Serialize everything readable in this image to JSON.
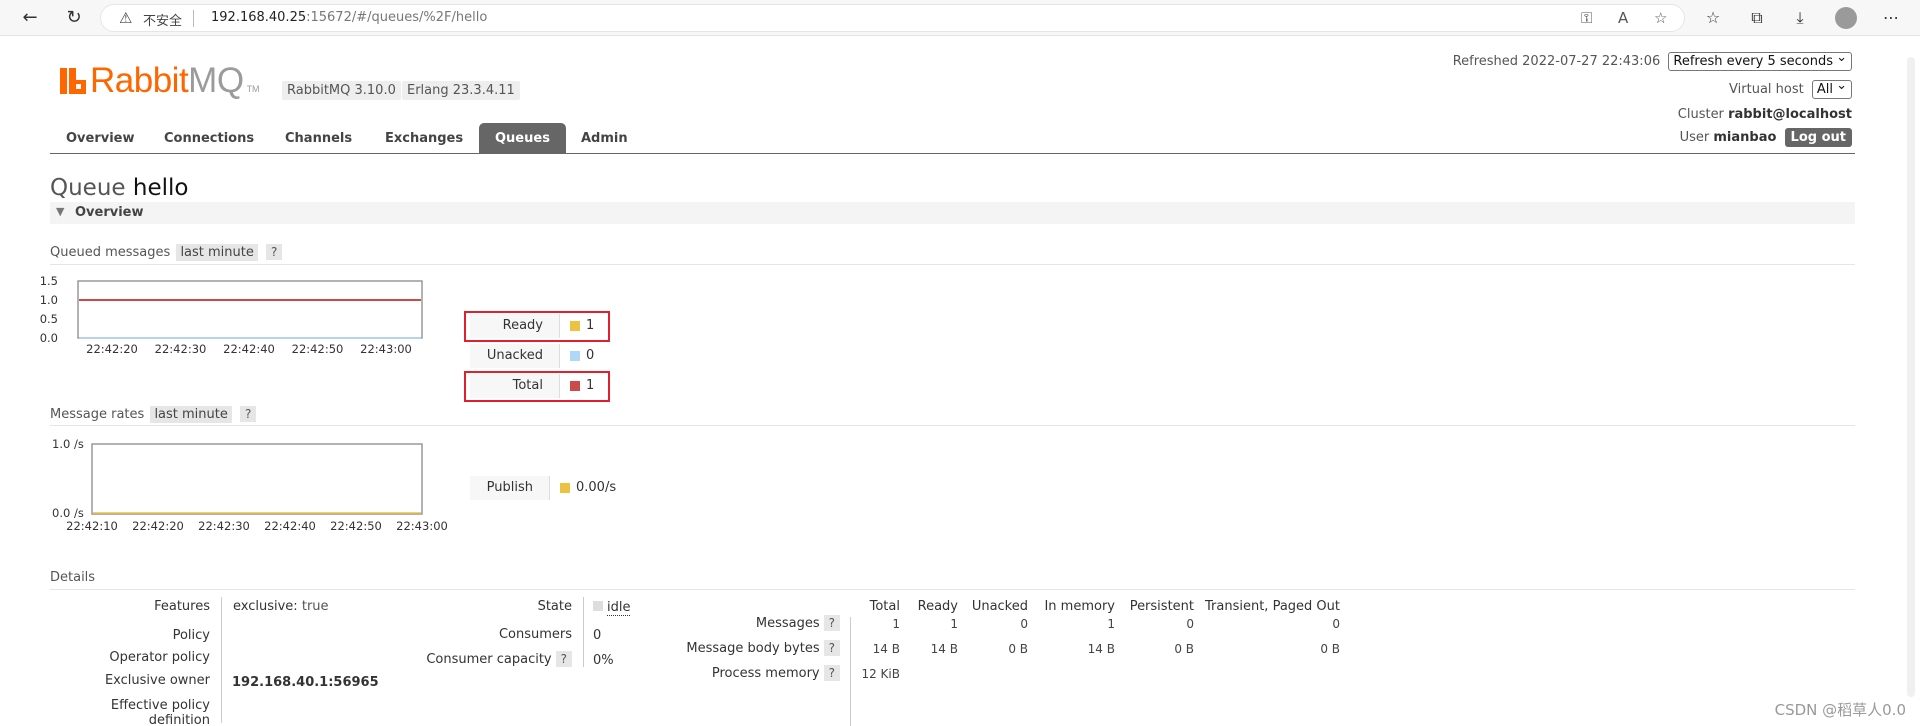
{
  "browser": {
    "insecure_label": "不安全",
    "url_host": "192.168.40.25",
    "url_rest": ":15672/#/queues/%2F/hello"
  },
  "header": {
    "logo_text": "Rabbit",
    "logo_mq": "MQ",
    "logo_tm": "TM",
    "rabbitmq_version": "RabbitMQ 3.10.0",
    "erlang_version": "Erlang 23.3.4.11",
    "refreshed_label": "Refreshed 2022-07-27 22:43:06",
    "refresh_select": "Refresh every 5 seconds",
    "vhost_label": "Virtual host",
    "vhost_select": "All",
    "cluster_label": "Cluster",
    "cluster_value": "rabbit@localhost",
    "user_label": "User",
    "user_value": "mianbao",
    "logout_label": "Log out"
  },
  "tabs": [
    "Overview",
    "Connections",
    "Channels",
    "Exchanges",
    "Queues",
    "Admin"
  ],
  "active_tab": "Queues",
  "queue": {
    "title_prefix": "Queue",
    "name": "hello"
  },
  "overview_section": "Overview",
  "queued_messages": {
    "title": "Queued messages",
    "range_tag": "last minute",
    "help": "?",
    "legend": [
      {
        "label": "Ready",
        "value": "1",
        "color": "#edc240"
      },
      {
        "label": "Unacked",
        "value": "0",
        "color": "#afd8f8"
      },
      {
        "label": "Total",
        "value": "1",
        "color": "#cb4b4b"
      }
    ]
  },
  "message_rates": {
    "title": "Message rates",
    "range_tag": "last minute",
    "help": "?",
    "legend": [
      {
        "label": "Publish",
        "value": "0.00/s",
        "color": "#edc240"
      }
    ]
  },
  "chart_data": [
    {
      "type": "line",
      "x": [
        "22:42:20",
        "22:42:30",
        "22:42:40",
        "22:42:50",
        "22:43:00"
      ],
      "y_ticks": [
        "1.5",
        "1.0",
        "0.5",
        "0.0"
      ],
      "ylim": [
        0,
        1.5
      ],
      "series": [
        {
          "name": "Ready",
          "values": [
            1,
            1,
            1,
            1,
            1
          ],
          "color": "#edc240"
        },
        {
          "name": "Unacked",
          "values": [
            0,
            0,
            0,
            0,
            0
          ],
          "color": "#afd8f8"
        },
        {
          "name": "Total",
          "values": [
            1,
            1,
            1,
            1,
            1
          ],
          "color": "#cb4b4b"
        }
      ]
    },
    {
      "type": "line",
      "x": [
        "22:42:10",
        "22:42:20",
        "22:42:30",
        "22:42:40",
        "22:42:50",
        "22:43:00"
      ],
      "y_ticks": [
        "1.0 /s",
        "0.0 /s"
      ],
      "ylim": [
        0,
        1
      ],
      "series": [
        {
          "name": "Publish",
          "values": [
            0,
            0,
            0,
            0,
            0,
            0
          ],
          "color": "#edc240"
        }
      ]
    }
  ],
  "details": {
    "title": "Details",
    "features_label": "Features",
    "features_key": "exclusive:",
    "features_val": "true",
    "policy_label": "Policy",
    "operator_policy_label": "Operator policy",
    "exclusive_owner_label": "Exclusive owner",
    "exclusive_owner_value": "192.168.40.1:56965",
    "effective_policy_label": "Effective policy definition",
    "state_label": "State",
    "state_value": "idle",
    "consumers_label": "Consumers",
    "consumers_value": "0",
    "consumer_capacity_label": "Consumer capacity",
    "consumer_capacity_help": "?",
    "consumer_capacity_value": "0%",
    "stats_headers": [
      "Total",
      "Ready",
      "Unacked",
      "In memory",
      "Persistent",
      "Transient, Paged Out"
    ],
    "messages_label": "Messages",
    "messages_help": "?",
    "messages_values": [
      "1",
      "1",
      "0",
      "1",
      "0",
      "0"
    ],
    "body_bytes_label": "Message body bytes",
    "body_bytes_help": "?",
    "body_bytes_values": [
      "14 B",
      "14 B",
      "0 B",
      "14 B",
      "0 B",
      "0 B"
    ],
    "process_memory_label": "Process memory",
    "process_memory_help": "?",
    "process_memory_value": "12 KiB"
  },
  "watermark": "CSDN @稻草人0.0"
}
